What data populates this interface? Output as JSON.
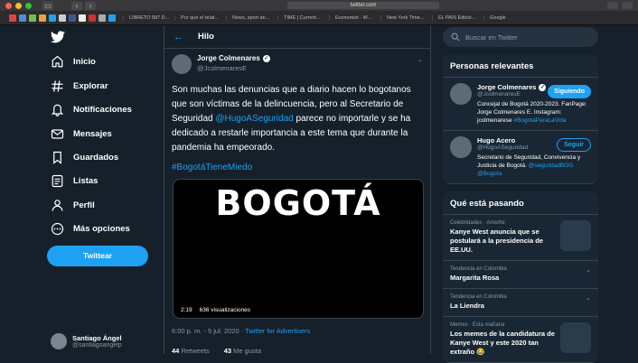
{
  "browser": {
    "url": "twitter.com",
    "bookmark_tabs": [
      "LIBRETO 587 D...",
      "Por qué el relat...",
      "News, sport an...",
      "TIME | Current...",
      "Economist - W...",
      "New York Time...",
      "EL PAÍS Edició...",
      "Google"
    ]
  },
  "sidebar": {
    "items": [
      {
        "label": "Inicio",
        "icon": "home-icon"
      },
      {
        "label": "Explorar",
        "icon": "hashtag-icon"
      },
      {
        "label": "Notificaciones",
        "icon": "bell-icon"
      },
      {
        "label": "Mensajes",
        "icon": "mail-icon"
      },
      {
        "label": "Guardados",
        "icon": "bookmark-icon"
      },
      {
        "label": "Listas",
        "icon": "list-icon"
      },
      {
        "label": "Perfil",
        "icon": "profile-icon"
      },
      {
        "label": "Más opciones",
        "icon": "more-icon"
      }
    ],
    "tweet_button": "Twittear",
    "account": {
      "name": "Santiago Ángel",
      "handle": "@santiagoangelp"
    }
  },
  "thread": {
    "header": "Hilo",
    "author": {
      "name": "Jorge Colmenares",
      "handle": "@JcolmenaresE"
    },
    "text_1": "Son muchas las denuncias que a diario hacen lo bogotanos que son víctimas de la delincuencia, pero al Secretario de Seguridad ",
    "mention": "@HugoASeguridad",
    "text_2": " parece no importarle y se ha dedicado a restarle importancia a este tema que durante la pandemia ha empeorado.",
    "hashtag": "#BogotáTieneMiedo",
    "video": {
      "word": "BOGOTÁ",
      "duration": "2:19",
      "views": "636 visualizaciones"
    },
    "timestamp": "6:00 p. m. - 5 jul. 2020 · ",
    "source": "Twitter for Advertisers",
    "stats": [
      {
        "count": "44",
        "label": "Retweets"
      },
      {
        "count": "43",
        "label": "Me gusta"
      }
    ]
  },
  "search": {
    "placeholder": "Buscar en Twitter"
  },
  "relevant": {
    "title": "Personas relevantes",
    "people": [
      {
        "name": "Jorge Colmenares",
        "handle": "@JcolmenaresE",
        "button": "Siguiendo",
        "bio": "Concejal de Bogotá 2020-2023. FanPage: Jorge Colmenares E. Instagram: jcolmenarese",
        "bio_link": "#BogotáParaLaVida"
      },
      {
        "name": "Hugo Acero",
        "handle": "@HugoASeguridad",
        "button": "Seguir",
        "bio": "Secretario de Seguridad, Convivencia y Justicia de Bogotá.",
        "bio_link": "@seguridadBOG @Bogota"
      }
    ]
  },
  "trends": {
    "title": "Qué está pasando",
    "items": [
      {
        "meta": "Celebridades · Anoche",
        "title": "Kanye West anuncia que se postulará a la presidencia de EE.UU."
      },
      {
        "meta": "Tendencia en Colombia",
        "title": "Margarita Rosa"
      },
      {
        "meta": "Tendencia en Colombia",
        "title": "La Liendra"
      },
      {
        "meta": "Memes · Esta mañana",
        "title": "Los memes de la candidatura de Kanye West y este 2020 tan extraño 😂"
      }
    ]
  },
  "colors": {
    "background": "#15202b",
    "accent": "#1da1f2",
    "card": "#192734",
    "border": "#38444d",
    "muted": "#8899a6"
  }
}
